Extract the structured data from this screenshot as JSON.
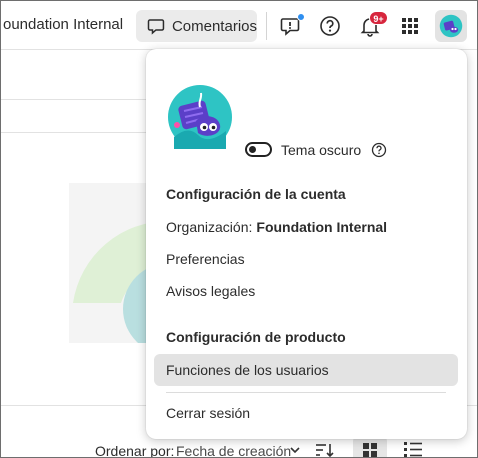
{
  "header": {
    "org_name": "oundation Internal",
    "comments_label": "Comentarios",
    "notifications_badge": "9+"
  },
  "profile_menu": {
    "theme_label": "Tema oscuro",
    "account_heading": "Configuración de la cuenta",
    "organization_prefix": "Organización:",
    "organization_name": "Foundation Internal",
    "preferences": "Preferencias",
    "legal": "Avisos legales",
    "product_heading": "Configuración de producto",
    "user_roles": "Funciones de los usuarios",
    "sign_out": "Cerrar sesión"
  },
  "toolbar": {
    "sort_label": "Ordenar por:",
    "sort_value": "Fecha de creación"
  },
  "colors": {
    "badge": "#d7263d",
    "notification_dot": "#2f8ff0",
    "avatar_bg": "#2ec4c4",
    "avatar_accent": "#5b3fc8"
  }
}
